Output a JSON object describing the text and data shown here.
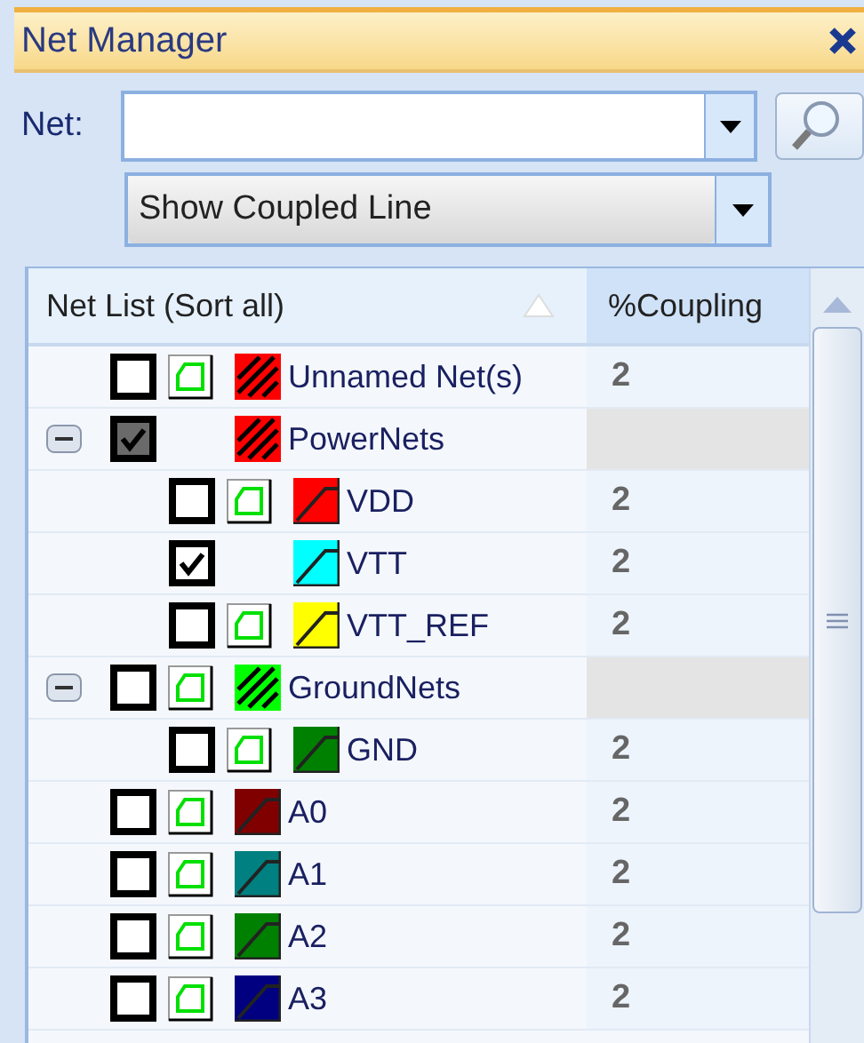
{
  "panel": {
    "title": "Net Manager"
  },
  "net_field": {
    "label": "Net:"
  },
  "mode_dropdown": {
    "value": "Show Coupled Line"
  },
  "table": {
    "columns": [
      "Net List (Sort all)",
      "%Coupling"
    ],
    "rows": [
      {
        "kind": "group",
        "name": "Unnamed Net(s)",
        "checked": false,
        "partial": false,
        "outline": true,
        "color": "#ff0000",
        "coupling": "2"
      },
      {
        "kind": "group",
        "name": "PowerNets",
        "checked": true,
        "partial": true,
        "outline": false,
        "color": "#ff0000",
        "expanded": true,
        "children": [
          {
            "kind": "net",
            "name": "VDD",
            "checked": false,
            "partial": false,
            "outline": true,
            "color": "#ff0000",
            "coupling": "2"
          },
          {
            "kind": "net",
            "name": "VTT",
            "checked": true,
            "partial": false,
            "outline": false,
            "color": "#00ffff",
            "coupling": "2"
          },
          {
            "kind": "net",
            "name": "VTT_REF",
            "checked": false,
            "partial": false,
            "outline": true,
            "color": "#ffff00",
            "coupling": "2"
          }
        ]
      },
      {
        "kind": "group",
        "name": "GroundNets",
        "checked": false,
        "partial": false,
        "outline": true,
        "color": "#00ff00",
        "expanded": true,
        "children": [
          {
            "kind": "net",
            "name": "GND",
            "checked": false,
            "partial": false,
            "outline": true,
            "color": "#008000",
            "coupling": "2"
          }
        ]
      },
      {
        "kind": "net",
        "name": "A0",
        "checked": false,
        "partial": false,
        "outline": true,
        "color": "#800000",
        "coupling": "2"
      },
      {
        "kind": "net",
        "name": "A1",
        "checked": false,
        "partial": false,
        "outline": true,
        "color": "#008080",
        "coupling": "2"
      },
      {
        "kind": "net",
        "name": "A2",
        "checked": false,
        "partial": false,
        "outline": true,
        "color": "#008000",
        "coupling": "2"
      },
      {
        "kind": "net",
        "name": "A3",
        "checked": false,
        "partial": false,
        "outline": true,
        "color": "#000080",
        "coupling": "2"
      }
    ]
  }
}
